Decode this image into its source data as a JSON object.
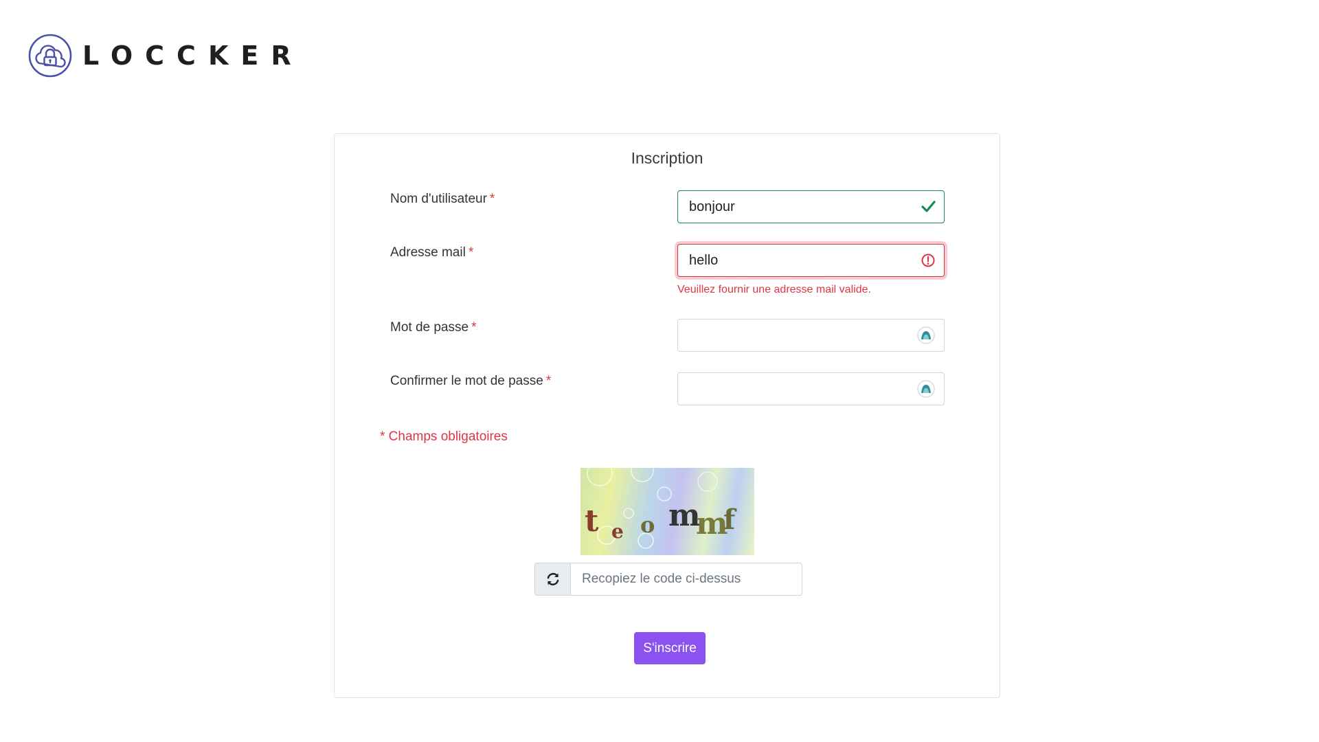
{
  "brand": {
    "name": "LOCCKER"
  },
  "form": {
    "title": "Inscription",
    "username": {
      "label": "Nom d'utilisateur",
      "required_mark": "*",
      "value": "bonjour",
      "state": "valid"
    },
    "email": {
      "label": "Adresse mail",
      "required_mark": "*",
      "value": "hello",
      "state": "invalid",
      "error": "Veuillez fournir une adresse mail valide."
    },
    "password": {
      "label": "Mot de passe",
      "required_mark": "*",
      "value": ""
    },
    "confirm_password": {
      "label": "Confirmer le mot de passe",
      "required_mark": "*",
      "value": ""
    },
    "required_note": "* Champs obligatoires",
    "captcha": {
      "code": "teommf",
      "placeholder": "Recopiez le code ci-dessus"
    },
    "submit_label": "S'inscrire"
  },
  "icons": {
    "valid": "check-icon",
    "invalid": "alert-circle-icon",
    "password_manager": "password-manager-icon",
    "refresh": "refresh-icon",
    "logo": "cloud-lock-icon"
  },
  "colors": {
    "accent": "#8c52ef",
    "valid": "#198754",
    "error": "#dc3545",
    "logo": "#4b4fa6"
  }
}
